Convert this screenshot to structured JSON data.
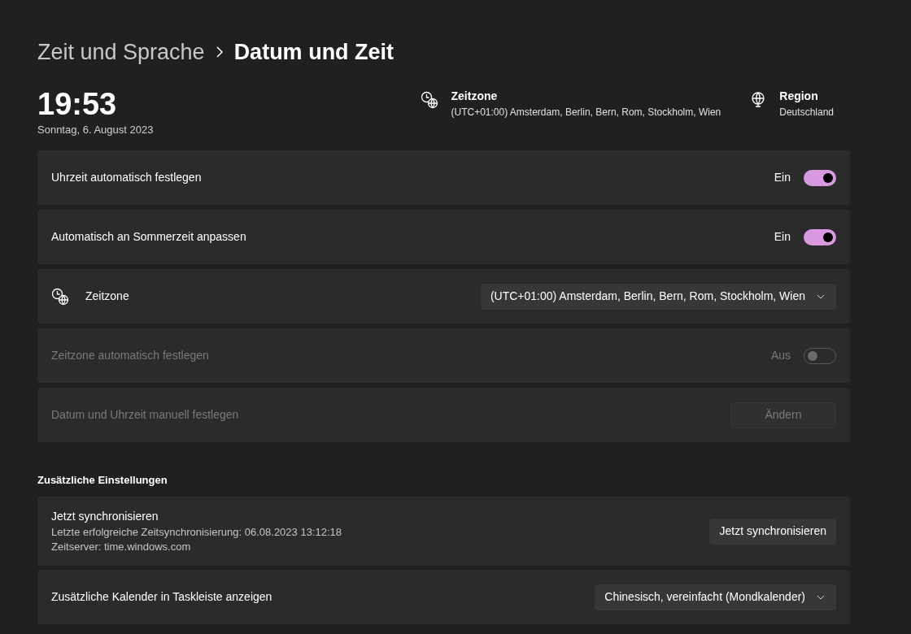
{
  "breadcrumb": {
    "parent": "Zeit und Sprache",
    "current": "Datum und Zeit"
  },
  "clock": {
    "time": "19:53",
    "date": "Sonntag, 6. August 2023"
  },
  "header_info": [
    {
      "kind": "timezone",
      "title": "Zeitzone",
      "value": "(UTC+01:00) Amsterdam, Berlin, Bern, Rom, Stockholm, Wien"
    },
    {
      "kind": "region",
      "title": "Region",
      "value": "Deutschland"
    }
  ],
  "settings": [
    {
      "kind": "toggle",
      "label": "Uhrzeit automatisch festlegen",
      "state_label": "Ein",
      "on": true,
      "disabled": false
    },
    {
      "kind": "toggle",
      "label": "Automatisch an Sommerzeit anpassen",
      "state_label": "Ein",
      "on": true,
      "disabled": false
    },
    {
      "kind": "dropdown",
      "icon": true,
      "label": "Zeitzone",
      "value": "(UTC+01:00) Amsterdam, Berlin, Bern, Rom, Stockholm, Wien",
      "disabled": false
    },
    {
      "kind": "toggle",
      "label": "Zeitzone automatisch festlegen",
      "state_label": "Aus",
      "on": false,
      "disabled": true
    },
    {
      "kind": "button",
      "label": "Datum und Uhrzeit manuell festlegen",
      "button": "Ändern",
      "disabled": true
    }
  ],
  "additional": {
    "heading": "Zusätzliche Einstellungen",
    "settings": [
      {
        "kind": "button",
        "label": "Jetzt synchronisieren",
        "details": [
          "Letzte erfolgreiche Zeitsynchronisierung: 06.08.2023 13:12:18",
          "Zeitserver: time.windows.com"
        ],
        "button": "Jetzt synchronisieren",
        "disabled": false
      },
      {
        "kind": "dropdown",
        "label": "Zusätzliche Kalender in Taskleiste anzeigen",
        "value": "Chinesisch, vereinfacht (Mondkalender)",
        "disabled": false
      }
    ]
  }
}
